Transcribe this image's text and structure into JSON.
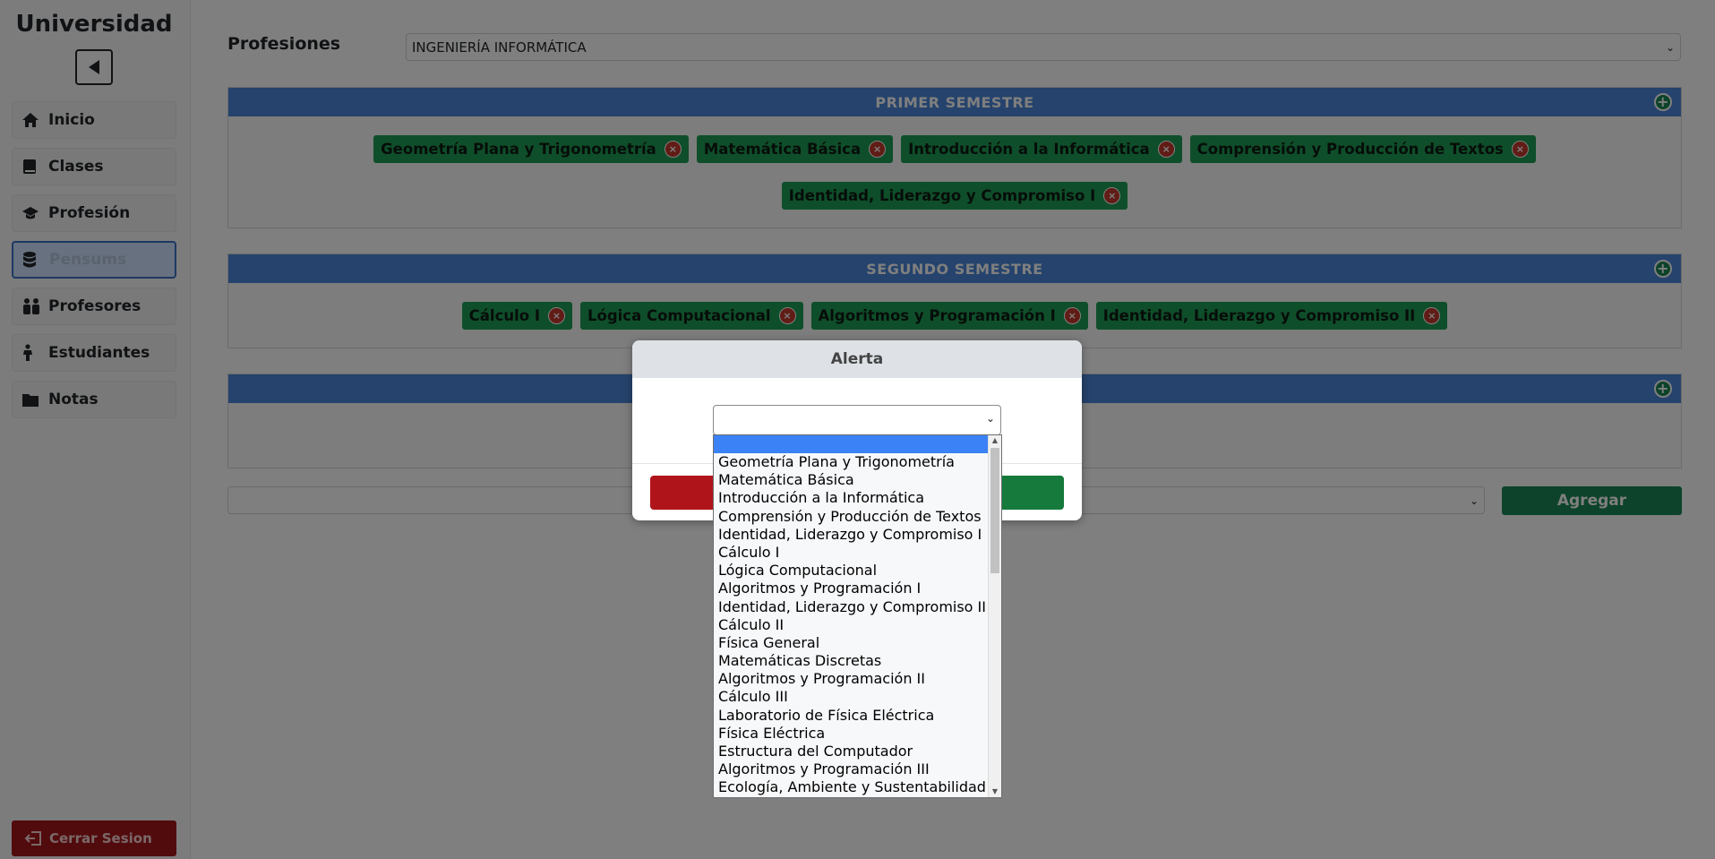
{
  "sidebar": {
    "brand": "Universidad",
    "items": [
      {
        "label": "Inicio",
        "icon": "home-icon"
      },
      {
        "label": "Clases",
        "icon": "book-icon"
      },
      {
        "label": "Profesión",
        "icon": "graduation-cap-icon"
      },
      {
        "label": "Pensums",
        "icon": "database-icon",
        "active": true
      },
      {
        "label": "Profesores",
        "icon": "people-icon"
      },
      {
        "label": "Estudiantes",
        "icon": "person-icon"
      },
      {
        "label": "Notas",
        "icon": "folder-icon"
      }
    ],
    "logout_label": "Cerrar Sesion"
  },
  "main": {
    "profession_label": "Profesiones",
    "profession_value": "INGENIERÍA INFORMÁTICA",
    "semesters": [
      {
        "title": "PRIMER SEMESTRE",
        "courses": [
          "Geometría Plana y Trigonometría",
          "Matemática Básica",
          "Introducción a la Informática",
          "Comprensión y Producción de Textos",
          "Identidad, Liderazgo y Compromiso I"
        ]
      },
      {
        "title": "SEGUNDO SEMESTRE",
        "courses": [
          "Cálculo I",
          "Lógica Computacional",
          "Algoritmos y Programación I",
          "Identidad, Liderazgo y Compromiso II"
        ]
      },
      {
        "title": "",
        "courses": []
      }
    ],
    "add_button": "Agregar",
    "new_semester_select": ""
  },
  "modal": {
    "title": "Alerta",
    "select_value": "",
    "options": [
      "",
      "Geometría Plana y Trigonometría",
      "Matemática Básica",
      "Introducción a la Informática",
      "Comprensión y Producción de Textos",
      "Identidad, Liderazgo y Compromiso I",
      "Cálculo I",
      "Lógica Computacional",
      "Algoritmos y Programación I",
      "Identidad, Liderazgo y Compromiso II",
      "Cálculo II",
      "Física General",
      "Matemáticas Discretas",
      "Algoritmos y Programación II",
      "Cálculo III",
      "Laboratorio de Física Eléctrica",
      "Física Eléctrica",
      "Estructura del Computador",
      "Algoritmos y Programación III",
      "Ecología, Ambiente y Sustentabilidad"
    ]
  },
  "colors": {
    "chip": "#1f9d55",
    "panel_header": "#4a86d8",
    "add_button": "#198754",
    "logout": "#a4161a"
  }
}
